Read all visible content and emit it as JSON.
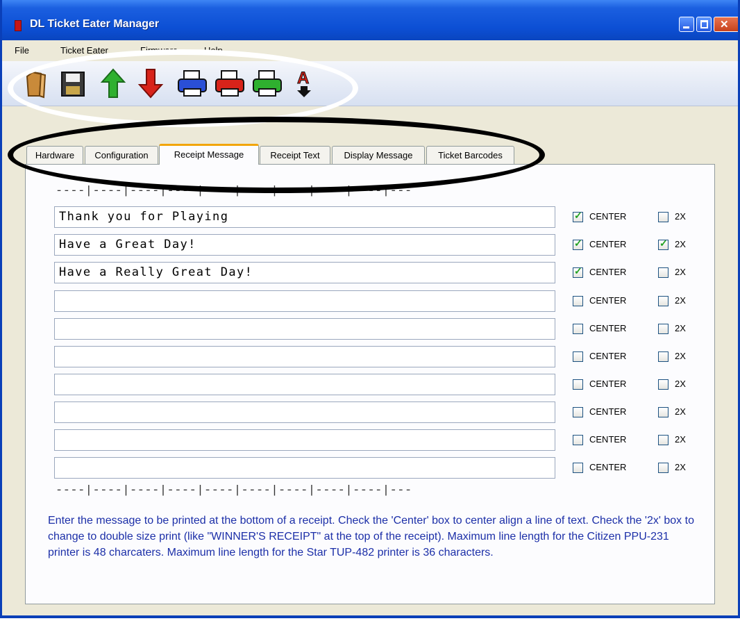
{
  "window": {
    "title": "DL Ticket Eater Manager"
  },
  "menu": {
    "items": [
      "File",
      "Ticket Eater",
      "Firmware",
      "Help"
    ]
  },
  "toolbar": {
    "buttons": [
      {
        "icon": "open-folder-icon"
      },
      {
        "icon": "save-disk-icon"
      },
      {
        "icon": "upload-green-arrow-icon"
      },
      {
        "icon": "download-red-arrow-icon"
      },
      {
        "icon": "printer-blue-icon"
      },
      {
        "icon": "printer-red-icon"
      },
      {
        "icon": "printer-green-icon"
      },
      {
        "icon": "font-down-icon"
      }
    ]
  },
  "tabs": [
    {
      "label": "Hardware",
      "active": false
    },
    {
      "label": "Configuration",
      "active": false
    },
    {
      "label": "Receipt Message",
      "active": true
    },
    {
      "label": "Receipt Text",
      "active": false
    },
    {
      "label": "Display Message",
      "active": false
    },
    {
      "label": "Ticket Barcodes",
      "active": false
    }
  ],
  "ruler": {
    "text": "----|----|----|----|----|----|----|----|----|---"
  },
  "rows": [
    {
      "text": "Thank you for Playing",
      "center": true,
      "double": false
    },
    {
      "text": "Have a Great Day!",
      "center": true,
      "double": true
    },
    {
      "text": "Have a Really Great Day!",
      "center": true,
      "double": false
    },
    {
      "text": "",
      "center": false,
      "double": false
    },
    {
      "text": "",
      "center": false,
      "double": false
    },
    {
      "text": "",
      "center": false,
      "double": false
    },
    {
      "text": "",
      "center": false,
      "double": false
    },
    {
      "text": "",
      "center": false,
      "double": false
    },
    {
      "text": "",
      "center": false,
      "double": false
    },
    {
      "text": "",
      "center": false,
      "double": false
    }
  ],
  "labels": {
    "center": "CENTER",
    "double": "2X"
  },
  "help_text": "Enter the message to be printed at the bottom of a receipt.  Check the 'Center' box to center align a line of text.  Check the '2x' box to change to double size print (like \"WINNER'S RECEIPT\" at the top of the receipt).  Maximum line length for the Citizen PPU-231 printer is 48 charcaters. Maximum line length for the Star TUP-482 printer is 36 characters.",
  "colors": {
    "titlebar": "#0c4fd4",
    "help_text": "#1c2fa8",
    "active_tab_accent": "#f2a50a"
  }
}
